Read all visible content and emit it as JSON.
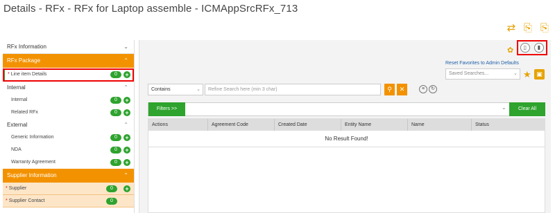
{
  "title": "Details - RFx - RFx for Laptop assemble - ICMAppSrcRFx_713",
  "top_icons": [
    "⇄",
    "⎘",
    "⎘"
  ],
  "sidebar": {
    "rfx_information": "RFx Information",
    "rfx_package": "RFx Package",
    "line_item": {
      "label": "Line item Details",
      "count": "0",
      "required": "*"
    },
    "internal": {
      "label": "Internal",
      "items": [
        {
          "label": "Internal",
          "count": "0"
        },
        {
          "label": "Related RFx",
          "count": "0"
        }
      ]
    },
    "external": {
      "label": "External",
      "items": [
        {
          "label": "Generic Information",
          "count": "0"
        },
        {
          "label": "NDA",
          "count": "0"
        },
        {
          "label": "Warranty Agreement",
          "count": "0"
        }
      ]
    },
    "supplier_information": "Supplier Information",
    "supplier_items": [
      {
        "label": "Supplier",
        "count": "0",
        "required": "*"
      },
      {
        "label": "Supplier Contact",
        "count": "0",
        "required": "*"
      }
    ]
  },
  "toolbar": {
    "reset_favorites": "Reset Favorites to Admin Defaults",
    "saved_searches_placeholder": "Saved Searches...",
    "contains_value": "Contains",
    "refine_placeholder": "Refine Search here (min 3 char)"
  },
  "filters": {
    "filters_label": "Filters >>",
    "clear_all": "Clear All"
  },
  "table": {
    "columns": [
      "Actions",
      "Agreement Code",
      "Created Date",
      "Entity Name",
      "Name",
      "Status"
    ],
    "empty_message": "No Result Found!"
  },
  "colors": {
    "orange": "#f39200",
    "green": "#2ea32e",
    "highlight_red": "#e00000",
    "link_blue": "#1f5fa8"
  }
}
